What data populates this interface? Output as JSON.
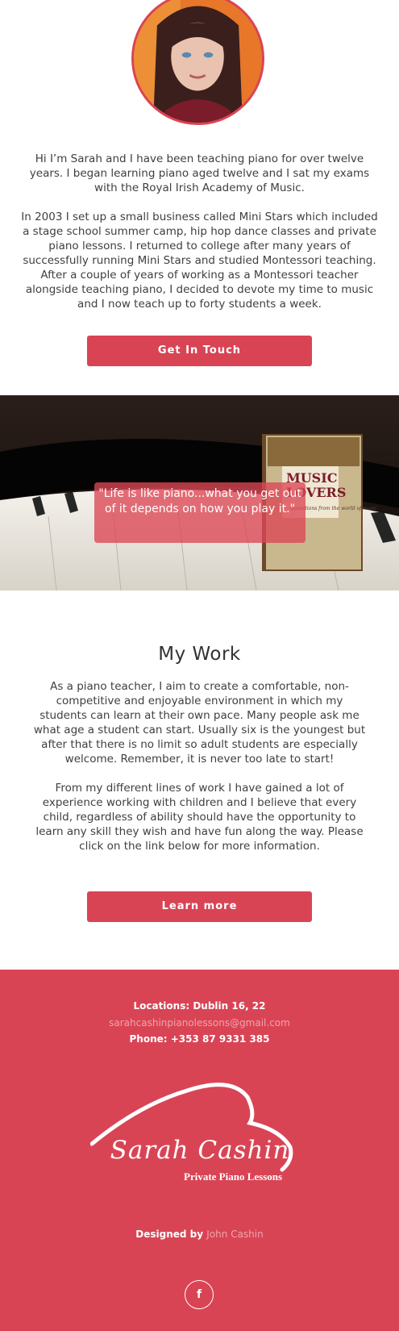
{
  "profile": {
    "avatar_alt": "Sarah portrait"
  },
  "intro": {
    "paragraph1": "Hi I’m Sarah and I have been teaching piano for over twelve years. I began learning piano aged twelve and I sat my exams with the Royal Irish Academy of Music.",
    "paragraph2": "In 2003 I set up a small business called Mini Stars which included a stage school summer camp, hip hop dance classes and private piano lessons. I returned to college after many years of successfully running Mini Stars and studied Montessori teaching. After a couple of years of working as a Montessori teacher alongside teaching piano, I decided to devote my time to music and I now teach up to forty students a week.",
    "button_label": "Get In Touch"
  },
  "hero": {
    "quote": "\"Life is like piano...what you get out of it depends on how you play it.\"",
    "book_title_line1": "MUSIC",
    "book_title_line2": "LOVERS",
    "book_subtitle": "Quotations from the world of music"
  },
  "work": {
    "title": "My Work",
    "paragraph1": "As a piano teacher, I aim to create a comfortable, non-competitive and enjoyable environment in which my students can learn at their own pace. Many people ask me what age a student can start. Usually six is the youngest but after that there is no limit so adult students are especially welcome. Remember, it is never too late to start!",
    "paragraph2": "From my different lines of work I have gained a lot of experience working with children and I believe that every child, regardless of ability should have the opportunity to learn any skill they wish and have fun along the way. Please click on the link below for more information.",
    "button_label": "Learn more"
  },
  "footer": {
    "locations": "Locations: Dublin 16, 22",
    "email": "sarahcashinpianolessons@gmail.com",
    "phone": "Phone: +353 87 9331 385",
    "logo_name": "Sarah Cashin",
    "logo_subtitle": "Private Piano Lessons",
    "designed_by_label": "Designed by",
    "designer": "John Cashin",
    "facebook_glyph": "f"
  },
  "colors": {
    "accent": "#d94455",
    "link_muted": "#f0a3ab"
  }
}
